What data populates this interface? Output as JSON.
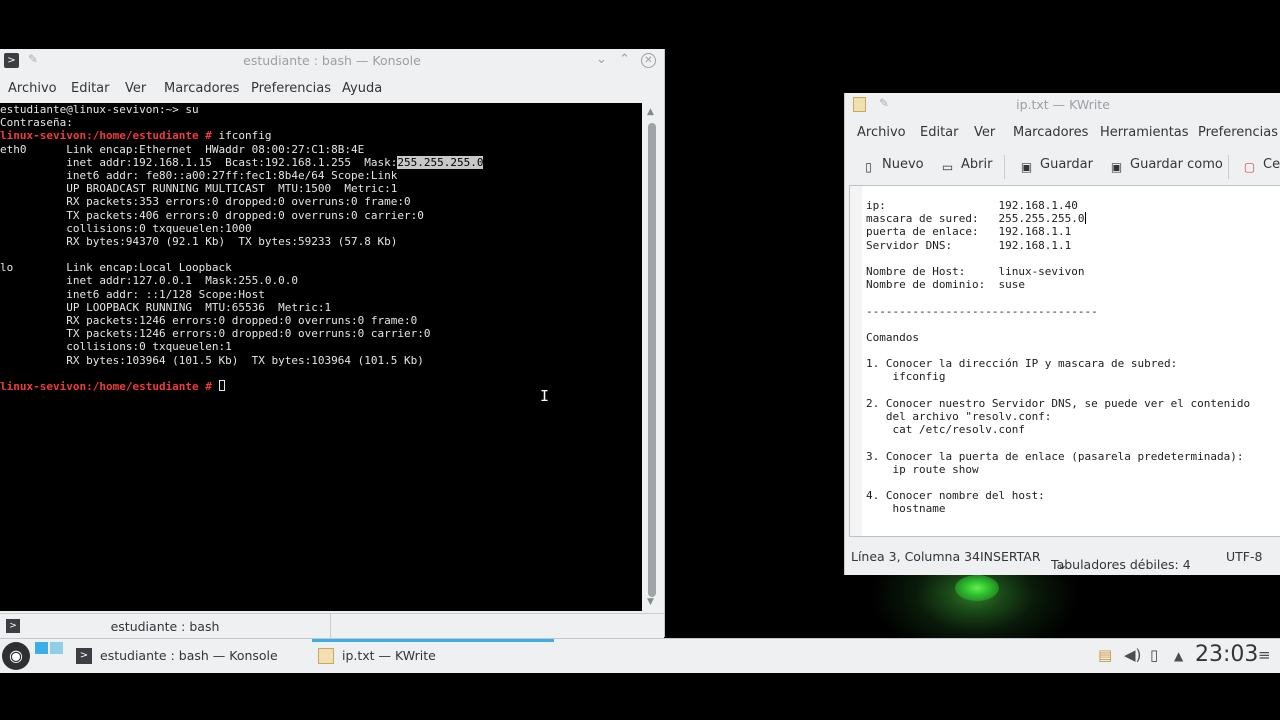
{
  "konsole": {
    "title": "estudiante : bash — Konsole",
    "menu": [
      "Archivo",
      "Editar",
      "Ver",
      "Marcadores",
      "Preferencias",
      "Ayuda"
    ],
    "terminal": {
      "lines": [
        {
          "prompt": "",
          "text": "estudiante@linux-sevivon:~> su"
        },
        {
          "prompt": "",
          "text": "Contraseña:"
        },
        {
          "prompt": "linux-sevivon:/home/estudiante #",
          "text": " ifconfig"
        },
        {
          "prompt": "",
          "text": "eth0      Link encap:Ethernet  HWaddr 08:00:27:C1:8B:4E"
        },
        {
          "prompt": "",
          "text": "          inet addr:192.168.1.15  Bcast:192.168.1.255  Mask:",
          "selected": "255.255.255.0"
        },
        {
          "prompt": "",
          "text": "          inet6 addr: fe80::a00:27ff:fec1:8b4e/64 Scope:Link"
        },
        {
          "prompt": "",
          "text": "          UP BROADCAST RUNNING MULTICAST  MTU:1500  Metric:1"
        },
        {
          "prompt": "",
          "text": "          RX packets:353 errors:0 dropped:0 overruns:0 frame:0"
        },
        {
          "prompt": "",
          "text": "          TX packets:406 errors:0 dropped:0 overruns:0 carrier:0"
        },
        {
          "prompt": "",
          "text": "          collisions:0 txqueuelen:1000"
        },
        {
          "prompt": "",
          "text": "          RX bytes:94370 (92.1 Kb)  TX bytes:59233 (57.8 Kb)"
        },
        {
          "prompt": "",
          "text": ""
        },
        {
          "prompt": "",
          "text": "lo        Link encap:Local Loopback"
        },
        {
          "prompt": "",
          "text": "          inet addr:127.0.0.1  Mask:255.0.0.0"
        },
        {
          "prompt": "",
          "text": "          inet6 addr: ::1/128 Scope:Host"
        },
        {
          "prompt": "",
          "text": "          UP LOOPBACK RUNNING  MTU:65536  Metric:1"
        },
        {
          "prompt": "",
          "text": "          RX packets:1246 errors:0 dropped:0 overruns:0 frame:0"
        },
        {
          "prompt": "",
          "text": "          TX packets:1246 errors:0 dropped:0 overruns:0 carrier:0"
        },
        {
          "prompt": "",
          "text": "          collisions:0 txqueuelen:1"
        },
        {
          "prompt": "",
          "text": "          RX bytes:103964 (101.5 Kb)  TX bytes:103964 (101.5 Kb)"
        },
        {
          "prompt": "",
          "text": ""
        },
        {
          "prompt": "linux-sevivon:/home/estudiante #",
          "text": " ",
          "cursor": true
        }
      ]
    },
    "tab_label": "estudiante : bash"
  },
  "kwrite": {
    "title": "ip.txt  — KWrite",
    "menu": [
      "Archivo",
      "Editar",
      "Ver",
      "Marcadores",
      "Herramientas",
      "Preferencias"
    ],
    "toolbar": [
      {
        "icon": "new-document-icon",
        "label": "Nuevo"
      },
      {
        "icon": "open-folder-icon",
        "label": "Abrir"
      },
      {
        "icon": "save-icon",
        "label": "Guardar"
      },
      {
        "icon": "save-as-icon",
        "label": "Guardar como"
      },
      {
        "icon": "close-document-icon",
        "label": "Ce"
      }
    ],
    "document_lines": [
      "ip:                 192.168.1.40",
      "mascara de sured:   255.255.255.0",
      "puerta de enlace:   192.168.1.1",
      "Servidor DNS:       192.168.1.1",
      "",
      "Nombre de Host:     linux-sevivon",
      "Nombre de dominio:  suse",
      "",
      "-----------------------------------",
      "",
      "Comandos",
      "",
      "1. Conocer la dirección IP y mascara de subred:",
      "    ifconfig",
      "",
      "2. Conocer nuestro Servidor DNS, se puede ver el contenido",
      "   del archivo \"resolv.conf:",
      "    cat /etc/resolv.conf",
      "",
      "3. Conocer la puerta de enlace (pasarela predeterminada):",
      "    ip route show",
      "",
      "4. Conocer nombre del host:",
      "    hostname"
    ],
    "status": {
      "position": "Línea 3, Columna 34",
      "mode": "INSERTAR",
      "indent": "Tabuladores débiles: 4",
      "encoding": "UTF-8"
    }
  },
  "taskbar": {
    "tasks": [
      {
        "icon": "terminal-icon",
        "label": "estudiante : bash — Konsole"
      },
      {
        "icon": "text-editor-icon",
        "label": "ip.txt  — KWrite"
      }
    ],
    "tray_icons": [
      "clipboard-icon",
      "volume-icon",
      "battery-icon",
      "expand-tray-icon"
    ],
    "clock": "23:03"
  }
}
